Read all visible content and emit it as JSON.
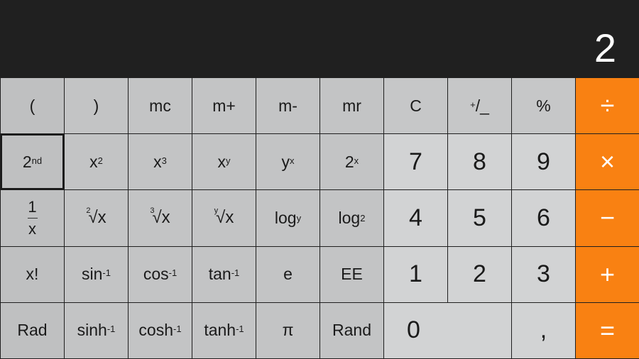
{
  "display": {
    "value": "2"
  },
  "colors": {
    "operator": "#f98112",
    "display_bg": "#202020",
    "key_light": "#d2d3d4",
    "key_sci": "#c3c4c5"
  },
  "keys": {
    "open_paren": "(",
    "close_paren": ")",
    "mc": "mc",
    "m_plus": "m+",
    "m_minus": "m-",
    "mr": "mr",
    "clear": "C",
    "plus_minus_a": "+",
    "plus_minus_b": "/",
    "plus_minus_c": "_",
    "percent": "%",
    "divide": "÷",
    "second": {
      "base": "2",
      "sup": "nd"
    },
    "x_squared": {
      "base": "x",
      "sup": "2"
    },
    "x_cubed": {
      "base": "x",
      "sup": "3"
    },
    "x_pow_y": {
      "base": "x",
      "sup": "y"
    },
    "y_pow_x": {
      "base": "y",
      "sup": "x"
    },
    "two_pow_x": {
      "base": "2",
      "sup": "x"
    },
    "seven": "7",
    "eight": "8",
    "nine": "9",
    "multiply": "×",
    "reciprocal": {
      "num": "1",
      "den": "x"
    },
    "sqrt2": {
      "index": "2",
      "radicand": "√x"
    },
    "sqrt3": {
      "index": "3",
      "radicand": "√x"
    },
    "sqrty": {
      "index": "y",
      "radicand": "√x"
    },
    "log_y": {
      "base": "log",
      "sub": "y"
    },
    "log_2": {
      "base": "log",
      "sub": "2"
    },
    "four": "4",
    "five": "5",
    "six": "6",
    "minus": "−",
    "factorial": "x!",
    "asin": {
      "base": "sin",
      "sup": "-1"
    },
    "acos": {
      "base": "cos",
      "sup": "-1"
    },
    "atan": {
      "base": "tan",
      "sup": "-1"
    },
    "e": "e",
    "ee": "EE",
    "one": "1",
    "two": "2",
    "three": "3",
    "plus": "+",
    "rad": "Rad",
    "asinh": {
      "base": "sinh",
      "sup": "-1"
    },
    "acosh": {
      "base": "cosh",
      "sup": "-1"
    },
    "atanh": {
      "base": "tanh",
      "sup": "-1"
    },
    "pi": "π",
    "rand": "Rand",
    "zero": "0",
    "decimal": ",",
    "equals": "="
  }
}
